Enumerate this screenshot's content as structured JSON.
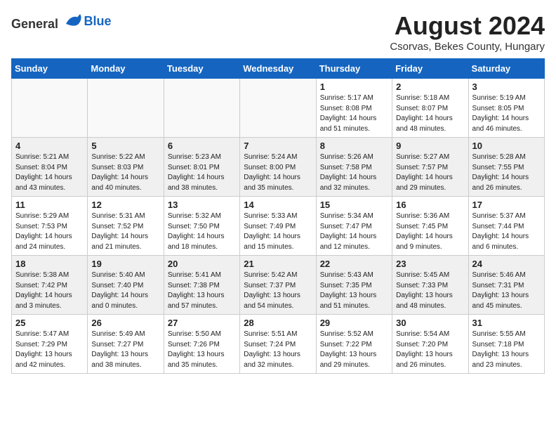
{
  "header": {
    "logo_general": "General",
    "logo_blue": "Blue",
    "month_title": "August 2024",
    "location": "Csorvas, Bekes County, Hungary"
  },
  "weekdays": [
    "Sunday",
    "Monday",
    "Tuesday",
    "Wednesday",
    "Thursday",
    "Friday",
    "Saturday"
  ],
  "weeks": [
    [
      {
        "day": "",
        "detail": ""
      },
      {
        "day": "",
        "detail": ""
      },
      {
        "day": "",
        "detail": ""
      },
      {
        "day": "",
        "detail": ""
      },
      {
        "day": "1",
        "detail": "Sunrise: 5:17 AM\nSunset: 8:08 PM\nDaylight: 14 hours\nand 51 minutes."
      },
      {
        "day": "2",
        "detail": "Sunrise: 5:18 AM\nSunset: 8:07 PM\nDaylight: 14 hours\nand 48 minutes."
      },
      {
        "day": "3",
        "detail": "Sunrise: 5:19 AM\nSunset: 8:05 PM\nDaylight: 14 hours\nand 46 minutes."
      }
    ],
    [
      {
        "day": "4",
        "detail": "Sunrise: 5:21 AM\nSunset: 8:04 PM\nDaylight: 14 hours\nand 43 minutes."
      },
      {
        "day": "5",
        "detail": "Sunrise: 5:22 AM\nSunset: 8:03 PM\nDaylight: 14 hours\nand 40 minutes."
      },
      {
        "day": "6",
        "detail": "Sunrise: 5:23 AM\nSunset: 8:01 PM\nDaylight: 14 hours\nand 38 minutes."
      },
      {
        "day": "7",
        "detail": "Sunrise: 5:24 AM\nSunset: 8:00 PM\nDaylight: 14 hours\nand 35 minutes."
      },
      {
        "day": "8",
        "detail": "Sunrise: 5:26 AM\nSunset: 7:58 PM\nDaylight: 14 hours\nand 32 minutes."
      },
      {
        "day": "9",
        "detail": "Sunrise: 5:27 AM\nSunset: 7:57 PM\nDaylight: 14 hours\nand 29 minutes."
      },
      {
        "day": "10",
        "detail": "Sunrise: 5:28 AM\nSunset: 7:55 PM\nDaylight: 14 hours\nand 26 minutes."
      }
    ],
    [
      {
        "day": "11",
        "detail": "Sunrise: 5:29 AM\nSunset: 7:53 PM\nDaylight: 14 hours\nand 24 minutes."
      },
      {
        "day": "12",
        "detail": "Sunrise: 5:31 AM\nSunset: 7:52 PM\nDaylight: 14 hours\nand 21 minutes."
      },
      {
        "day": "13",
        "detail": "Sunrise: 5:32 AM\nSunset: 7:50 PM\nDaylight: 14 hours\nand 18 minutes."
      },
      {
        "day": "14",
        "detail": "Sunrise: 5:33 AM\nSunset: 7:49 PM\nDaylight: 14 hours\nand 15 minutes."
      },
      {
        "day": "15",
        "detail": "Sunrise: 5:34 AM\nSunset: 7:47 PM\nDaylight: 14 hours\nand 12 minutes."
      },
      {
        "day": "16",
        "detail": "Sunrise: 5:36 AM\nSunset: 7:45 PM\nDaylight: 14 hours\nand 9 minutes."
      },
      {
        "day": "17",
        "detail": "Sunrise: 5:37 AM\nSunset: 7:44 PM\nDaylight: 14 hours\nand 6 minutes."
      }
    ],
    [
      {
        "day": "18",
        "detail": "Sunrise: 5:38 AM\nSunset: 7:42 PM\nDaylight: 14 hours\nand 3 minutes."
      },
      {
        "day": "19",
        "detail": "Sunrise: 5:40 AM\nSunset: 7:40 PM\nDaylight: 14 hours\nand 0 minutes."
      },
      {
        "day": "20",
        "detail": "Sunrise: 5:41 AM\nSunset: 7:38 PM\nDaylight: 13 hours\nand 57 minutes."
      },
      {
        "day": "21",
        "detail": "Sunrise: 5:42 AM\nSunset: 7:37 PM\nDaylight: 13 hours\nand 54 minutes."
      },
      {
        "day": "22",
        "detail": "Sunrise: 5:43 AM\nSunset: 7:35 PM\nDaylight: 13 hours\nand 51 minutes."
      },
      {
        "day": "23",
        "detail": "Sunrise: 5:45 AM\nSunset: 7:33 PM\nDaylight: 13 hours\nand 48 minutes."
      },
      {
        "day": "24",
        "detail": "Sunrise: 5:46 AM\nSunset: 7:31 PM\nDaylight: 13 hours\nand 45 minutes."
      }
    ],
    [
      {
        "day": "25",
        "detail": "Sunrise: 5:47 AM\nSunset: 7:29 PM\nDaylight: 13 hours\nand 42 minutes."
      },
      {
        "day": "26",
        "detail": "Sunrise: 5:49 AM\nSunset: 7:27 PM\nDaylight: 13 hours\nand 38 minutes."
      },
      {
        "day": "27",
        "detail": "Sunrise: 5:50 AM\nSunset: 7:26 PM\nDaylight: 13 hours\nand 35 minutes."
      },
      {
        "day": "28",
        "detail": "Sunrise: 5:51 AM\nSunset: 7:24 PM\nDaylight: 13 hours\nand 32 minutes."
      },
      {
        "day": "29",
        "detail": "Sunrise: 5:52 AM\nSunset: 7:22 PM\nDaylight: 13 hours\nand 29 minutes."
      },
      {
        "day": "30",
        "detail": "Sunrise: 5:54 AM\nSunset: 7:20 PM\nDaylight: 13 hours\nand 26 minutes."
      },
      {
        "day": "31",
        "detail": "Sunrise: 5:55 AM\nSunset: 7:18 PM\nDaylight: 13 hours\nand 23 minutes."
      }
    ]
  ]
}
